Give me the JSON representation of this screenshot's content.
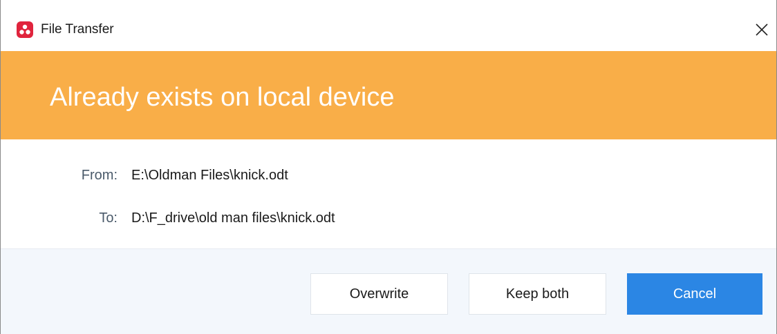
{
  "window": {
    "title": "File Transfer",
    "app_icon": "remote-app-logo-icon",
    "close_icon": "close-icon"
  },
  "banner": {
    "message": "Already exists on local device",
    "color": "#f9ae48"
  },
  "details": {
    "from_label": "From:",
    "from_value": "E:\\Oldman Files\\knick.odt",
    "to_label": "To:",
    "to_value": "D:\\F_drive\\old man files\\knick.odt"
  },
  "actions": {
    "overwrite_label": "Overwrite",
    "keep_both_label": "Keep both",
    "cancel_label": "Cancel",
    "primary_color": "#2b86e4"
  }
}
